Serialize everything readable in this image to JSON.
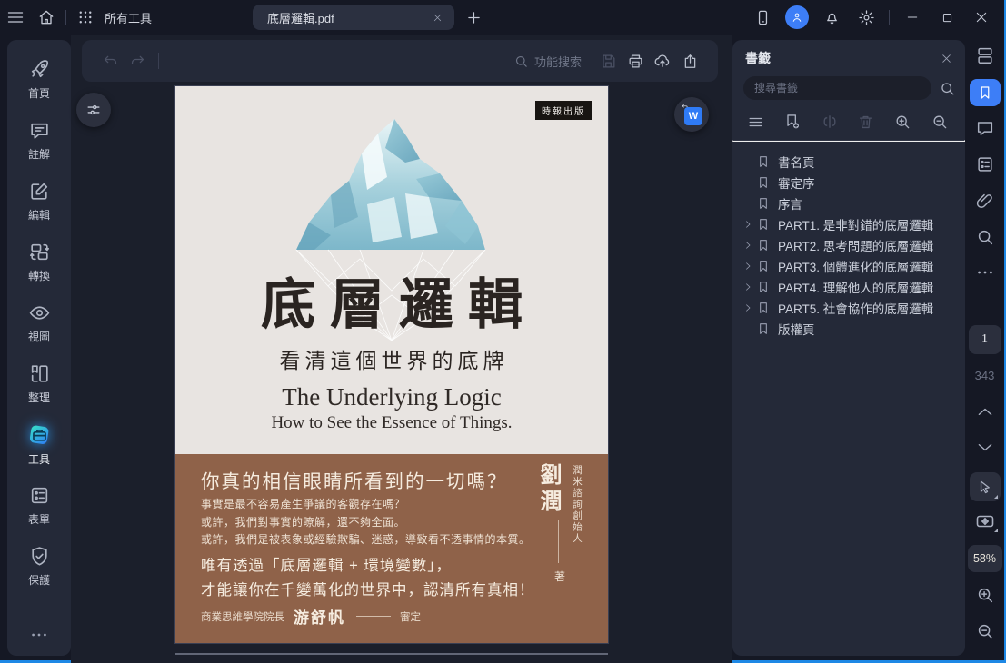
{
  "titlebar": {
    "all_tools_label": "所有工具",
    "tab_title": "底層邏輯.pdf"
  },
  "toolbar": {
    "function_search_label": "功能搜索"
  },
  "sidebar": {
    "items": [
      {
        "label": "首頁"
      },
      {
        "label": "註解"
      },
      {
        "label": "編輯"
      },
      {
        "label": "轉換"
      },
      {
        "label": "視圖"
      },
      {
        "label": "整理"
      },
      {
        "label": "工具",
        "active": true
      },
      {
        "label": "表單"
      },
      {
        "label": "保護"
      }
    ]
  },
  "document": {
    "cover": {
      "publisher_badge": "時報出版",
      "title": "底層邏輯",
      "subtitle": "看清這個世界的底牌",
      "title_en": "The Underlying Logic",
      "subtitle_en": "How to See the Essence of Things.",
      "tagline": "你真的相信眼睛所看到的一切嗎？",
      "body_lines": [
        "事實是最不容易產生爭議的客觀存在嗎？",
        "或許，我們對事實的瞭解，還不夠全面。",
        "或許，我們是被表象或經驗欺騙、迷惑，導致看不透事情的本質。"
      ],
      "emphasis_lines": [
        "唯有透過「底層邏輯 + 環境變數」，",
        "才能讓你在千變萬化的世界中，認清所有真相！"
      ],
      "reviewer_prefix": "商業思維學院院長",
      "reviewer_name": "游舒帆",
      "reviewer_suffix": "審定",
      "author_name": "劉潤",
      "author_title": "潤米諮詢創始人",
      "author_role": "著"
    }
  },
  "bookmarks_panel": {
    "title": "書籤",
    "search_placeholder": "搜尋書籤",
    "items": [
      {
        "label": "書名頁"
      },
      {
        "label": "審定序"
      },
      {
        "label": "序言"
      },
      {
        "label": "PART1. 是非對錯的底層邏輯",
        "expandable": true
      },
      {
        "label": "PART2. 思考問題的底層邏輯",
        "expandable": true
      },
      {
        "label": "PART3. 個體進化的底層邏輯",
        "expandable": true
      },
      {
        "label": "PART4. 理解他人的底層邏輯",
        "expandable": true
      },
      {
        "label": "PART5. 社會協作的底層邏輯",
        "expandable": true
      },
      {
        "label": "版權頁"
      }
    ]
  },
  "right_rail": {
    "current_page": "1",
    "total_pages": "343",
    "zoom_level": "58%"
  },
  "colors": {
    "accent_blue": "#3d7ef7",
    "window_edge_blue": "#1e88e5",
    "panel_bg": "#242938",
    "cover_brown": "#8f6249",
    "cover_paper": "#e8e4e1"
  }
}
